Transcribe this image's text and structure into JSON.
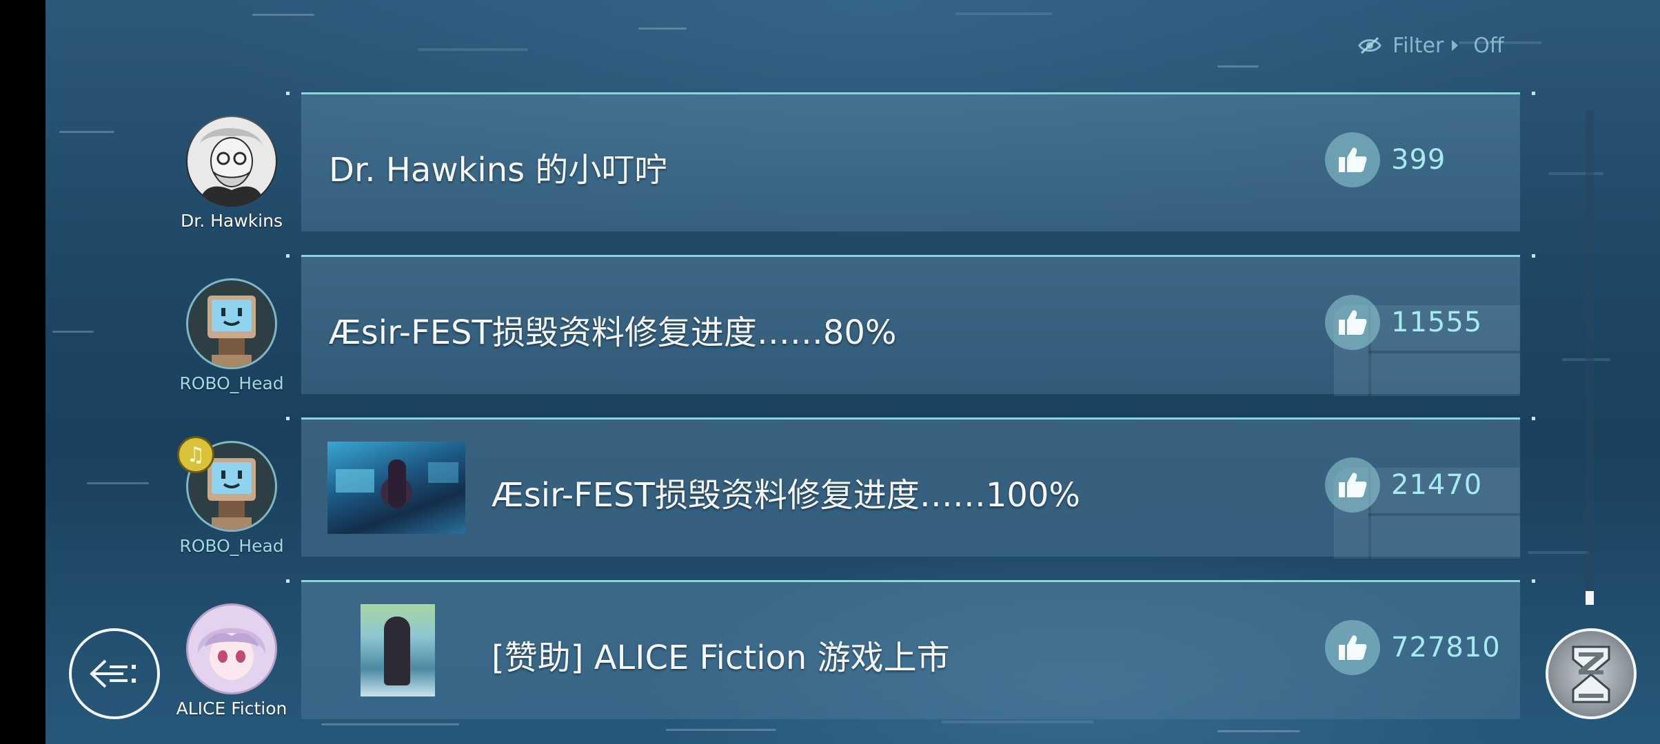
{
  "filter": {
    "label": "Filter",
    "value": "Off",
    "icon": "eye-slash-icon"
  },
  "posts": [
    {
      "author": "Dr. Hawkins",
      "title": "Dr. Hawkins 的小叮咛",
      "likes": "399",
      "has_image": false
    },
    {
      "author": "ROBO_Head",
      "title": "Æsir-FEST损毁资料修复进度……80%",
      "likes": "11555",
      "has_image": false
    },
    {
      "author": "ROBO_Head",
      "title": "Æsir-FEST损毁资料修复进度……100%",
      "likes": "21470",
      "has_image": true,
      "badge_icon": "music-note-icon"
    },
    {
      "author": "ALICE Fiction",
      "title": "[赞助] ALICE Fiction 游戏上市",
      "likes": "727810",
      "has_image": true
    }
  ],
  "scroll": {
    "position": 0.98
  },
  "buttons": {
    "back_icon": "back-arrow-icon",
    "corner_icon": "hourglass-emblem-icon"
  },
  "colors": {
    "accent": "#8fd2e0",
    "like_text": "#a8eaf2",
    "badge": "#d8c23a"
  }
}
